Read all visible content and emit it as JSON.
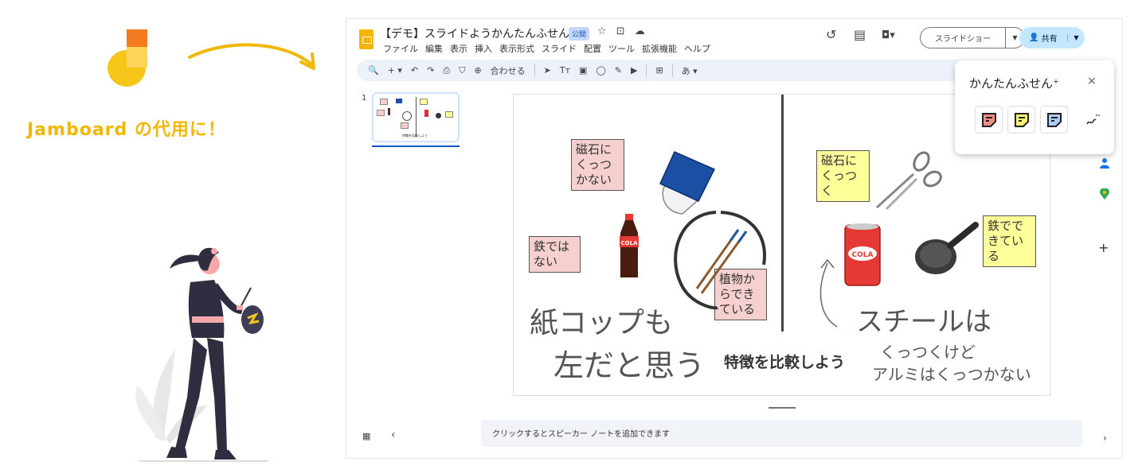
{
  "promo": {
    "title": "Jamboard の代用に！",
    "brand_color": "#f2b705"
  },
  "app": {
    "doc_title": "【デモ】スライドようかんたんふせん⁺",
    "badge": "公開",
    "title_icons": "☆ ⊡ ☁",
    "menu": [
      "ファイル",
      "編集",
      "表示",
      "挿入",
      "表示形式",
      "スライド",
      "配置",
      "ツール",
      "拡張機能",
      "ヘルプ"
    ],
    "history_icon": "↺",
    "comment_icon": "▤",
    "meet_icon": "◘▾",
    "slideshow_label": "スライドショー",
    "share_label": "共有",
    "toolbar": {
      "search_icon": "🔍",
      "add_icon": "+ ▾",
      "undo_icon": "↶",
      "redo_icon": "↷",
      "print_icon": "⎙",
      "paint_icon": "⛉",
      "zoom_icon": "⊕",
      "fit_label": "合わせる",
      "select_icon": "➤",
      "text_icon": "Tт",
      "image_icon": "▣",
      "shape_icon": "◯",
      "pen_icon": "✎",
      "video_icon": "▶",
      "comment_add_icon": "⊞",
      "input_tools": "あ ▾"
    },
    "slide_number": "1",
    "thumb_caption": "特徴を比較しよう",
    "speaker_notes_placeholder": "クリックするとスピーカー ノートを追加できます",
    "side_add": "+",
    "side_expand": "›"
  },
  "slide": {
    "notes": {
      "magnet_no": "磁石に くっつ かない",
      "iron_not": "鉄では ない",
      "plant": "植物か らでき ている",
      "magnet_yes": "磁石に くっつ く",
      "iron_made": "鉄でで きてい る"
    },
    "compare_title": "特徴を比較しよう",
    "handwriting": {
      "paper_cup_1": "紙コップも",
      "paper_cup_2": "左だと思う",
      "steel": "スチールは",
      "stick_1": "くっつくけど",
      "stick_2": "アルミはくっつかない"
    },
    "cola_label": "COLA"
  },
  "addon": {
    "title": "かんたんふせん⁺",
    "close_icon": "×",
    "colors": {
      "red": "#f28b82",
      "yellow": "#fff475",
      "blue": "#aecbfa"
    }
  }
}
